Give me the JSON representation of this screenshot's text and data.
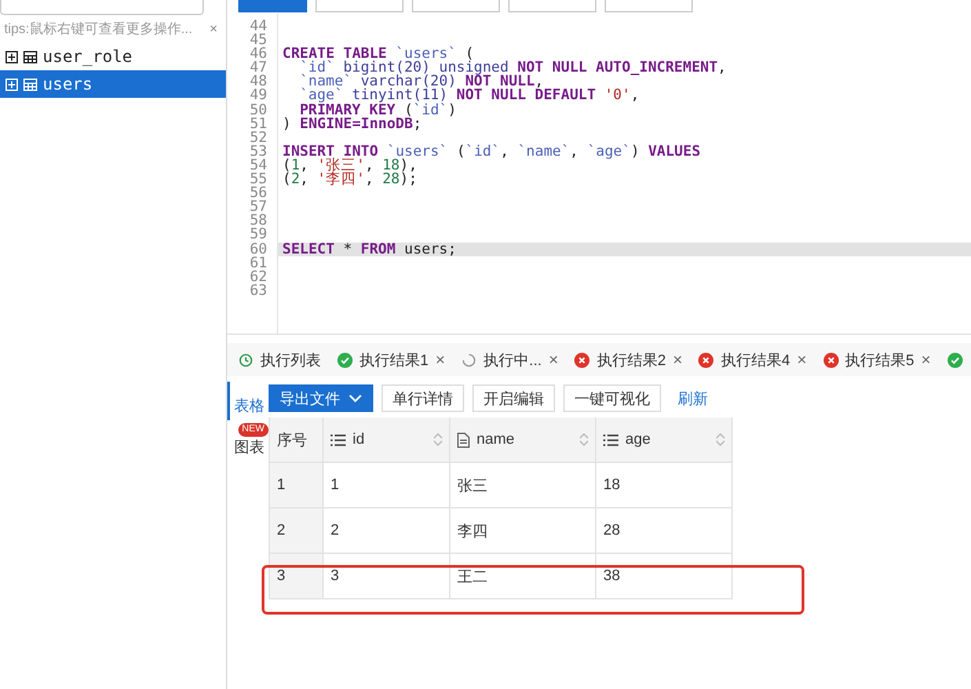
{
  "sidebar": {
    "tip": "tips:鼠标右键可查看更多操作...",
    "close": "×",
    "items": [
      {
        "label": "user_role",
        "selected": false
      },
      {
        "label": "users",
        "selected": true
      }
    ]
  },
  "editor": {
    "lines": [
      {
        "no": "44"
      },
      {
        "no": "45"
      },
      {
        "no": "46",
        "tokens": [
          {
            "kind": "k",
            "text": "CREATE TABLE"
          },
          {
            "kind": "i",
            "text": " `users`"
          },
          {
            "kind": "p",
            "text": " ("
          }
        ]
      },
      {
        "no": "47",
        "indent": true,
        "tokens": [
          {
            "kind": "i",
            "text": "`id`"
          },
          {
            "kind": "t",
            "text": " bigint(20) unsigned"
          },
          {
            "kind": "k",
            "text": " NOT NULL AUTO_INCREMENT"
          },
          {
            "kind": "p",
            "text": ","
          }
        ]
      },
      {
        "no": "48",
        "indent": true,
        "tokens": [
          {
            "kind": "i",
            "text": "`name`"
          },
          {
            "kind": "t",
            "text": " varchar(20)"
          },
          {
            "kind": "k",
            "text": " NOT NULL"
          },
          {
            "kind": "p",
            "text": ","
          }
        ]
      },
      {
        "no": "49",
        "indent": true,
        "tokens": [
          {
            "kind": "i",
            "text": "`age`"
          },
          {
            "kind": "t",
            "text": " tinyint(11)"
          },
          {
            "kind": "k",
            "text": " NOT NULL DEFAULT"
          },
          {
            "kind": "s",
            "text": " '0'"
          },
          {
            "kind": "p",
            "text": ","
          }
        ]
      },
      {
        "no": "50",
        "indent": true,
        "tokens": [
          {
            "kind": "k",
            "text": "PRIMARY KEY"
          },
          {
            "kind": "p",
            "text": " ("
          },
          {
            "kind": "i",
            "text": "`id`"
          },
          {
            "kind": "p",
            "text": ")"
          }
        ]
      },
      {
        "no": "51",
        "tokens": [
          {
            "kind": "p",
            "text": ")"
          },
          {
            "kind": "k",
            "text": " ENGINE=InnoDB"
          },
          {
            "kind": "p",
            "text": ";"
          }
        ]
      },
      {
        "no": "52"
      },
      {
        "no": "53",
        "tokens": [
          {
            "kind": "k",
            "text": "INSERT INTO"
          },
          {
            "kind": "i",
            "text": " `users`"
          },
          {
            "kind": "p",
            "text": " ("
          },
          {
            "kind": "i",
            "text": "`id`"
          },
          {
            "kind": "p",
            "text": ","
          },
          {
            "kind": "i",
            "text": " `name`"
          },
          {
            "kind": "p",
            "text": ","
          },
          {
            "kind": "i",
            "text": " `age`"
          },
          {
            "kind": "p",
            "text": ")"
          },
          {
            "kind": "k",
            "text": " VALUES"
          }
        ]
      },
      {
        "no": "54",
        "tokens": [
          {
            "kind": "p",
            "text": "("
          },
          {
            "kind": "n",
            "text": "1"
          },
          {
            "kind": "p",
            "text": ","
          },
          {
            "kind": "s",
            "text": " '张三'"
          },
          {
            "kind": "p",
            "text": ","
          },
          {
            "kind": "n",
            "text": " 18"
          },
          {
            "kind": "p",
            "text": "),"
          }
        ]
      },
      {
        "no": "55",
        "tokens": [
          {
            "kind": "p",
            "text": "("
          },
          {
            "kind": "n",
            "text": "2"
          },
          {
            "kind": "p",
            "text": ","
          },
          {
            "kind": "s",
            "text": " '李四'"
          },
          {
            "kind": "p",
            "text": ","
          },
          {
            "kind": "n",
            "text": " 28"
          },
          {
            "kind": "p",
            "text": ");"
          }
        ]
      },
      {
        "no": "56"
      },
      {
        "no": "57"
      },
      {
        "no": "58"
      },
      {
        "no": "59"
      },
      {
        "no": "60",
        "selected": true,
        "tokens": [
          {
            "kind": "k",
            "text": "SELECT"
          },
          {
            "kind": "p",
            "text": " *"
          },
          {
            "kind": "k",
            "text": " FROM"
          },
          {
            "kind": "p",
            "text": " users;"
          }
        ]
      },
      {
        "no": "61"
      },
      {
        "no": "62"
      },
      {
        "no": "63"
      }
    ]
  },
  "result_tabs": [
    {
      "label": "执行列表",
      "kind": "history"
    },
    {
      "label": "执行结果1",
      "kind": "success",
      "close": "×"
    },
    {
      "label": "执行中...",
      "kind": "running",
      "close": "×"
    },
    {
      "label": "执行结果2",
      "kind": "error",
      "close": "×"
    },
    {
      "label": "执行结果4",
      "kind": "error",
      "close": "×"
    },
    {
      "label": "执行结果5",
      "kind": "error",
      "close": "×"
    },
    {
      "kind": "success"
    }
  ],
  "view_tabs": [
    {
      "label": "表格",
      "selected": true
    },
    {
      "label": "图表",
      "selected": false,
      "badge": "NEW"
    }
  ],
  "toolbar": {
    "export": "导出文件",
    "buttons": [
      "单行详情",
      "开启编辑",
      "一键可视化"
    ],
    "refresh": "刷新"
  },
  "table": {
    "index_header": "序号",
    "columns": [
      {
        "name": "id",
        "kind": "list"
      },
      {
        "name": "name",
        "kind": "doc"
      },
      {
        "name": "age",
        "kind": "list"
      }
    ],
    "rows": [
      {
        "index": "1",
        "cells": [
          "1",
          "张三",
          "18"
        ]
      },
      {
        "index": "2",
        "cells": [
          "2",
          "李四",
          "28"
        ]
      },
      {
        "index": "3",
        "cells": [
          "3",
          "王二",
          "38"
        ],
        "marked": true
      }
    ]
  }
}
